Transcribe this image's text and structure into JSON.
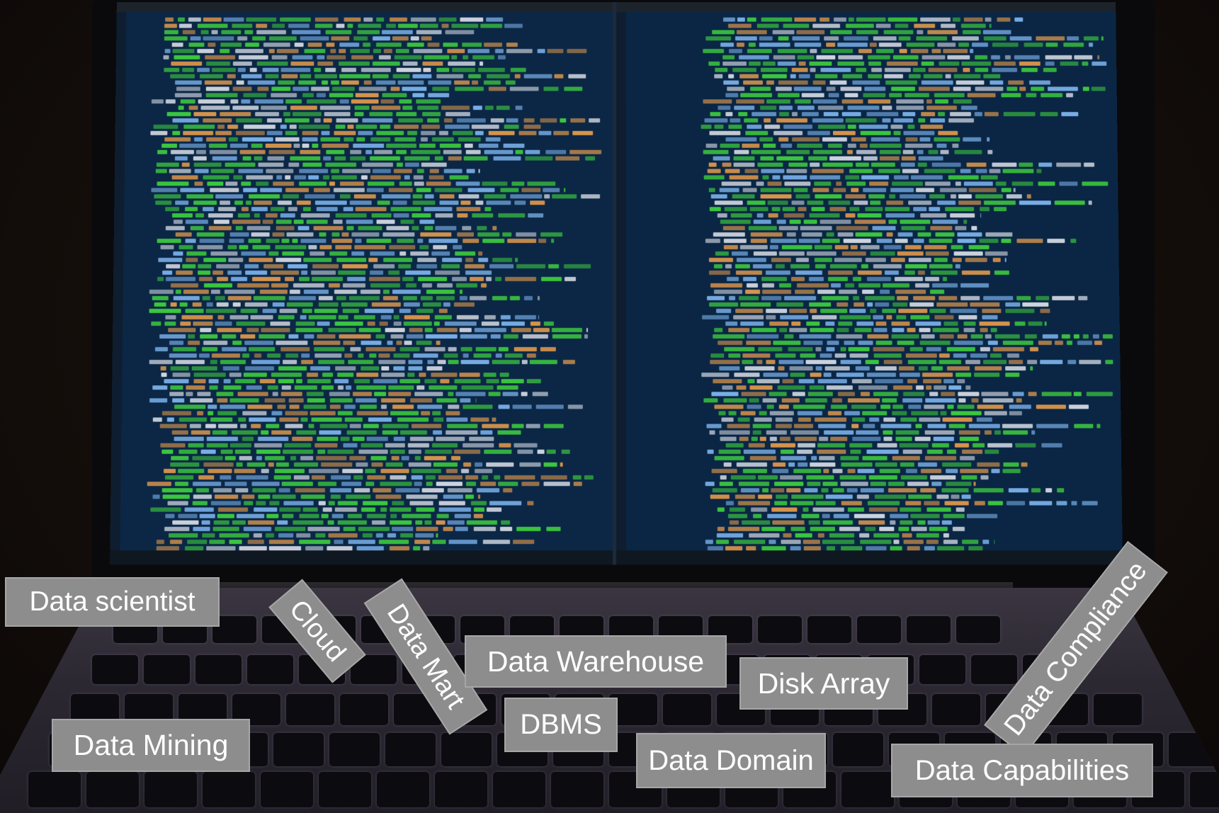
{
  "labels": {
    "data_scientist": "Data scientist",
    "cloud": "Cloud",
    "data_mart": "Data Mart",
    "data_warehouse": "Data Warehouse",
    "disk_array": "Disk Array",
    "data_compliance": "Data Compliance",
    "data_mining": "Data Mining",
    "dbms": "DBMS",
    "data_domain": "Data Domain",
    "data_capabilities": "Data Capabilities"
  },
  "colors": {
    "chip_background": "#8d8d8d",
    "chip_text": "#ffffff",
    "code_green": "#3ecf3e",
    "code_orange": "#e29a4c",
    "code_blue": "#7fb6f0",
    "code_white": "#d8dde6"
  },
  "icons": [
    "laptop-photo",
    "code-editor-screen",
    "keyboard"
  ]
}
